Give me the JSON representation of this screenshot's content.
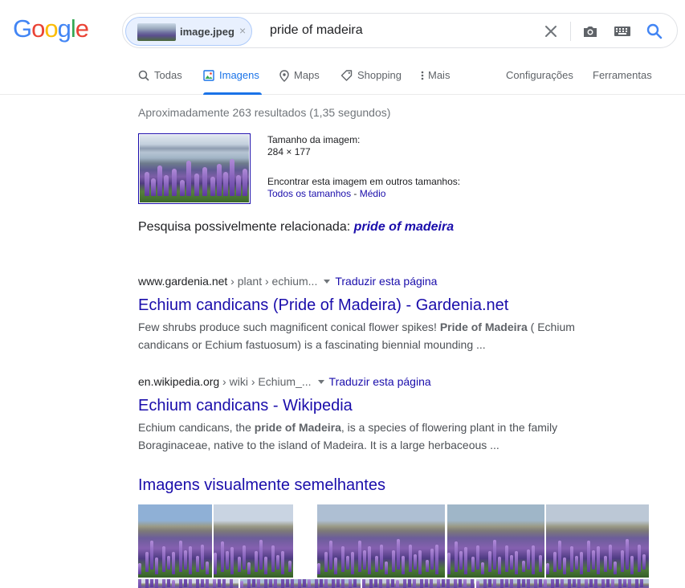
{
  "logo": {
    "text": "Google",
    "colors": [
      "#4285F4",
      "#EA4335",
      "#FBBC05",
      "#4285F4",
      "#34A853",
      "#EA4335"
    ]
  },
  "search": {
    "image_chip_label": "image.jpeg",
    "image_chip_close": "×",
    "query": "pride of madeira"
  },
  "tabs": [
    {
      "label": "Todas",
      "icon": "search-icon",
      "active": false
    },
    {
      "label": "Imagens",
      "icon": "image-icon",
      "active": true
    },
    {
      "label": "Maps",
      "icon": "map-pin-icon",
      "active": false
    },
    {
      "label": "Shopping",
      "icon": "tag-icon",
      "active": false
    },
    {
      "label": "Mais",
      "icon": "more-vert-icon",
      "active": false
    }
  ],
  "tools": {
    "settings": "Configurações",
    "tools": "Ferramentas"
  },
  "stats": "Aproximadamente 263 resultados (1,35 segundos)",
  "query_image": {
    "size_label": "Tamanho da imagem:",
    "size_value": "284 × 177",
    "other_sizes_label": "Encontrar esta imagem em outros tamanhos:",
    "all_sizes": "Todos os tamanhos",
    "separator": " - ",
    "medium": "Médio"
  },
  "related": {
    "label": "Pesquisa possivelmente relacionada: ",
    "link": "pride of madeira"
  },
  "results": [
    {
      "domain": "www.gardenia.net",
      "path": " › plant › echium...",
      "translate": "Traduzir esta página",
      "title": "Echium candicans (Pride of Madeira) - Gardenia.net",
      "snippet_line1_pre": "Few shrubs produce such magnificent conical flower spikes! ",
      "snippet_line1_bold": "Pride of Madeira",
      "snippet_line1_post": " ( Echium",
      "snippet_line2": "candicans or Echium fastuosum) is a fascinating biennial mounding ..."
    },
    {
      "domain": "en.wikipedia.org",
      "path": " › wiki › Echium_...",
      "translate": "Traduzir esta página",
      "title": "Echium candicans - Wikipedia",
      "snippet_line1_pre": "Echium candicans, the ",
      "snippet_line1_bold": "pride of Madeira",
      "snippet_line1_post": ", is a species of flowering plant in the family",
      "snippet_line2": "Boraginaceae, native to the island of Madeira. It is a large herbaceous ..."
    }
  ],
  "similar_title": "Imagens visualmente semelhantes"
}
